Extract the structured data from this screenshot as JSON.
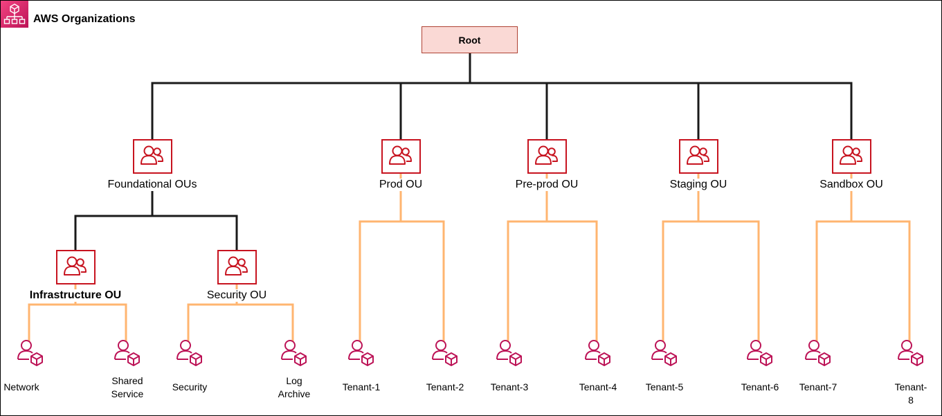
{
  "title": "AWS Organizations",
  "logo_icon": "aws-organizations-icon",
  "colors": {
    "root_fill": "#fad9d5",
    "root_border": "#ae4132",
    "ou_red": "#c7131f",
    "account_magenta": "#bc1356",
    "primary_line": "#1a1a1a",
    "account_line": "#ffb570"
  },
  "root": {
    "label": "Root"
  },
  "ous": [
    {
      "id": "foundational",
      "label": "Foundational OUs",
      "bold": false,
      "icon": "organizational-unit-icon",
      "parent": "root"
    },
    {
      "id": "prod",
      "label": "Prod OU",
      "bold": false,
      "icon": "organizational-unit-icon",
      "parent": "root"
    },
    {
      "id": "preprod",
      "label": "Pre-prod OU",
      "bold": false,
      "icon": "organizational-unit-icon",
      "parent": "root"
    },
    {
      "id": "staging",
      "label": "Staging OU",
      "bold": false,
      "icon": "organizational-unit-icon",
      "parent": "root"
    },
    {
      "id": "sandbox",
      "label": "Sandbox OU",
      "bold": false,
      "icon": "organizational-unit-icon",
      "parent": "root"
    },
    {
      "id": "infra",
      "label": "Infrastructure OU",
      "bold": true,
      "icon": "organizational-unit-icon",
      "parent": "foundational"
    },
    {
      "id": "security",
      "label": "Security OU",
      "bold": false,
      "icon": "organizational-unit-icon",
      "parent": "foundational"
    }
  ],
  "accounts": [
    {
      "label": "Network",
      "parent": "infra",
      "icon": "account-icon"
    },
    {
      "label": "Shared\nService",
      "parent": "infra",
      "icon": "account-icon"
    },
    {
      "label": "Security",
      "parent": "security",
      "icon": "account-icon"
    },
    {
      "label": "Log\nArchive",
      "parent": "security",
      "icon": "account-icon"
    },
    {
      "label": "Tenant-1",
      "parent": "prod",
      "icon": "account-icon"
    },
    {
      "label": "Tenant-2",
      "parent": "prod",
      "icon": "account-icon"
    },
    {
      "label": "Tenant-3",
      "parent": "preprod",
      "icon": "account-icon"
    },
    {
      "label": "Tenant-4",
      "parent": "preprod",
      "icon": "account-icon"
    },
    {
      "label": "Tenant-5",
      "parent": "staging",
      "icon": "account-icon"
    },
    {
      "label": "Tenant-6",
      "parent": "staging",
      "icon": "account-icon"
    },
    {
      "label": "Tenant-7",
      "parent": "sandbox",
      "icon": "account-icon"
    },
    {
      "label": "Tenant-8",
      "parent": "sandbox",
      "icon": "account-icon"
    }
  ]
}
